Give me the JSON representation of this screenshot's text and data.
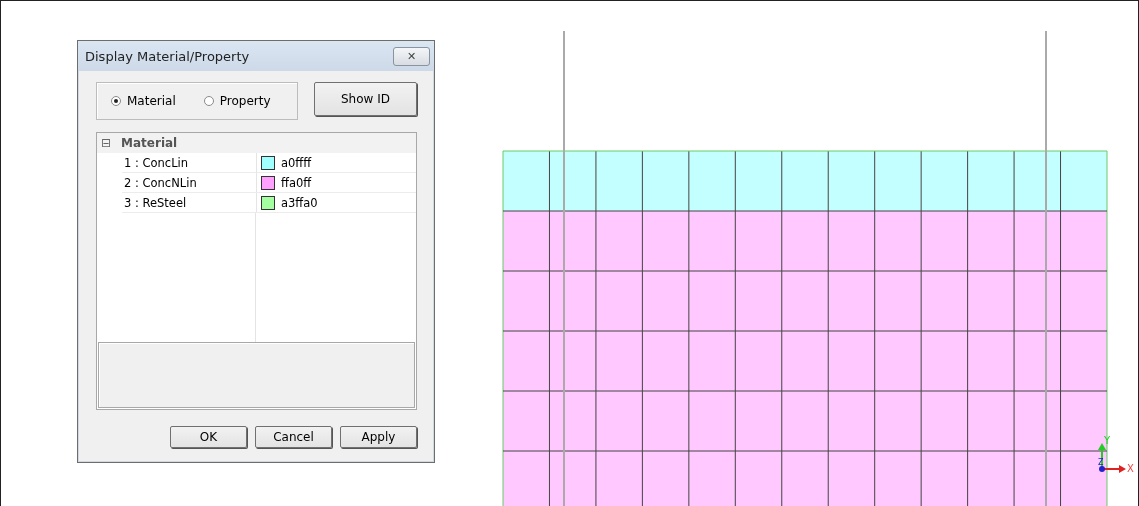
{
  "window": {
    "title": "Display Material/Property",
    "close": "✕"
  },
  "display_mode": [
    {
      "label": "Material",
      "selected": true
    },
    {
      "label": "Property",
      "selected": false
    }
  ],
  "show_id_button": "Show ID",
  "tree": {
    "label": "Material",
    "expanded": true,
    "toggle": "⊟",
    "items": [
      {
        "name": "1 : ConcLin",
        "value": "a0ffff",
        "color": "#a0ffff"
      },
      {
        "name": "2 : ConcNLin",
        "value": "ffa0ff",
        "color": "#ffa0ff"
      },
      {
        "name": "3 : ReSteel",
        "value": "a3ffa0",
        "color": "#a3ffa0"
      }
    ]
  },
  "buttons": [
    "OK",
    "Cancel",
    "Apply"
  ],
  "axes": {
    "x": "X",
    "y": "Y",
    "z": "Z"
  }
}
